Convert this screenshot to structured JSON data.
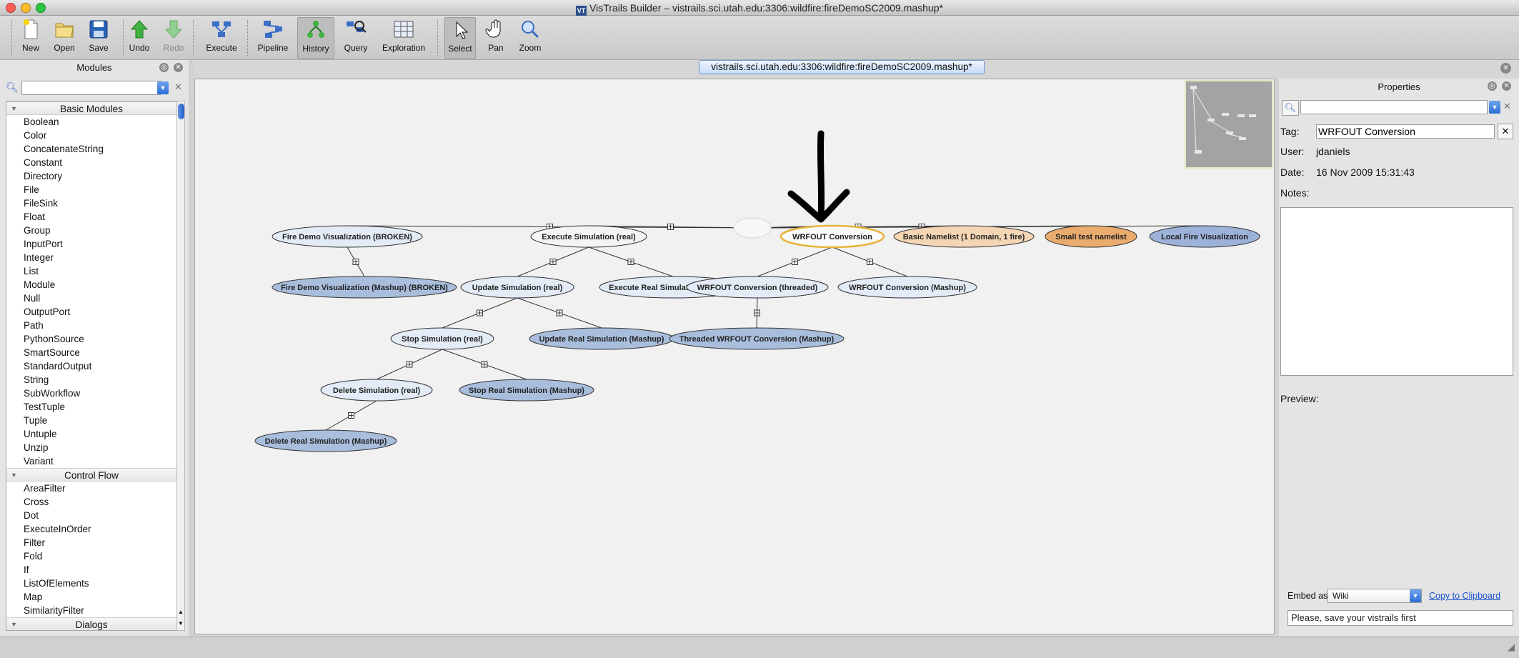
{
  "window": {
    "title": "VisTrails Builder – vistrails.sci.utah.edu:3306:wildfire:fireDemoSC2009.mashup*",
    "app_badge": "VT"
  },
  "toolbar": {
    "new": "New",
    "open": "Open",
    "save": "Save",
    "undo": "Undo",
    "redo": "Redo",
    "execute": "Execute",
    "pipeline": "Pipeline",
    "history": "History",
    "query": "Query",
    "exploration": "Exploration",
    "select": "Select",
    "pan": "Pan",
    "zoom": "Zoom"
  },
  "modules": {
    "header": "Modules",
    "search_value": "",
    "categories": [
      {
        "name": "Basic Modules",
        "items": [
          "Boolean",
          "Color",
          "ConcatenateString",
          "Constant",
          "Directory",
          "File",
          "FileSink",
          "Float",
          "Group",
          "InputPort",
          "Integer",
          "List",
          "Module",
          "Null",
          "OutputPort",
          "Path",
          "PythonSource",
          "SmartSource",
          "StandardOutput",
          "String",
          "SubWorkflow",
          "TestTuple",
          "Tuple",
          "Untuple",
          "Unzip",
          "Variant"
        ]
      },
      {
        "name": "Control Flow",
        "items": [
          "AreaFilter",
          "Cross",
          "Dot",
          "ExecuteInOrder",
          "Filter",
          "Fold",
          "If",
          "ListOfElements",
          "Map",
          "SimilarityFilter"
        ]
      },
      {
        "name": "Dialogs",
        "items": []
      }
    ]
  },
  "tab": {
    "label": "vistrails.sci.utah.edu:3306:wildfire:fireDemoSC2009.mashup*"
  },
  "tree": {
    "nodes": [
      {
        "id": "fire-demo-visualization-broken",
        "label": "Fire Demo Visualization (BROKEN)"
      },
      {
        "id": "fire-demo-visualization-mashup-broken",
        "label": "Fire Demo Visualization (Mashup) (BROKEN)"
      },
      {
        "id": "execute-simulation-real",
        "label": "Execute Simulation (real)"
      },
      {
        "id": "update-simulation-real",
        "label": "Update Simulation (real)"
      },
      {
        "id": "execute-real-simulation-mashup",
        "label": "Execute Real Simulation (Mashup)"
      },
      {
        "id": "stop-simulation-real",
        "label": "Stop Simulation (real)"
      },
      {
        "id": "update-real-simulation-mashup",
        "label": "Update Real Simulation (Mashup)"
      },
      {
        "id": "delete-simulation-real",
        "label": "Delete Simulation (real)"
      },
      {
        "id": "stop-real-simulation-mashup",
        "label": "Stop Real Simulation (Mashup)"
      },
      {
        "id": "delete-real-simulation-mashup",
        "label": "Delete Real Simulation (Mashup)"
      },
      {
        "id": "wrfout-conversion",
        "label": "WRFOUT Conversion"
      },
      {
        "id": "wrfout-conversion-threaded",
        "label": "WRFOUT Conversion (threaded)"
      },
      {
        "id": "wrfout-conversion-mashup",
        "label": "WRFOUT Conversion (Mashup)"
      },
      {
        "id": "threaded-wrfout-conversion-mashup",
        "label": "Threaded WRFOUT Conversion (Mashup)"
      },
      {
        "id": "basic-namelist",
        "label": "Basic Namelist (1 Domain, 1 fire)"
      },
      {
        "id": "small-test-namelist",
        "label": "Small test namelist"
      },
      {
        "id": "local-fire-visualization",
        "label": "Local Fire Visualization"
      }
    ],
    "colors": {
      "plain": "#e3ebf7",
      "mashup": "#a9bedd",
      "selected_outline": "#e8b339",
      "light_orange": "#f5d6b4",
      "orange": "#eaac6e",
      "blue": "#9cb2d9"
    }
  },
  "properties": {
    "header": "Properties",
    "tag_label": "Tag:",
    "tag_value": "WRFOUT Conversion",
    "user_label": "User:",
    "user_value": "jdaniels",
    "date_label": "Date:",
    "date_value": "16 Nov 2009 15:31:43",
    "notes_label": "Notes:",
    "preview_label": "Preview:",
    "embed_label": "Embed as:",
    "embed_value": "Wiki",
    "copy_link": "Copy to Clipboard",
    "save_message": "Please, save your vistrails first"
  }
}
